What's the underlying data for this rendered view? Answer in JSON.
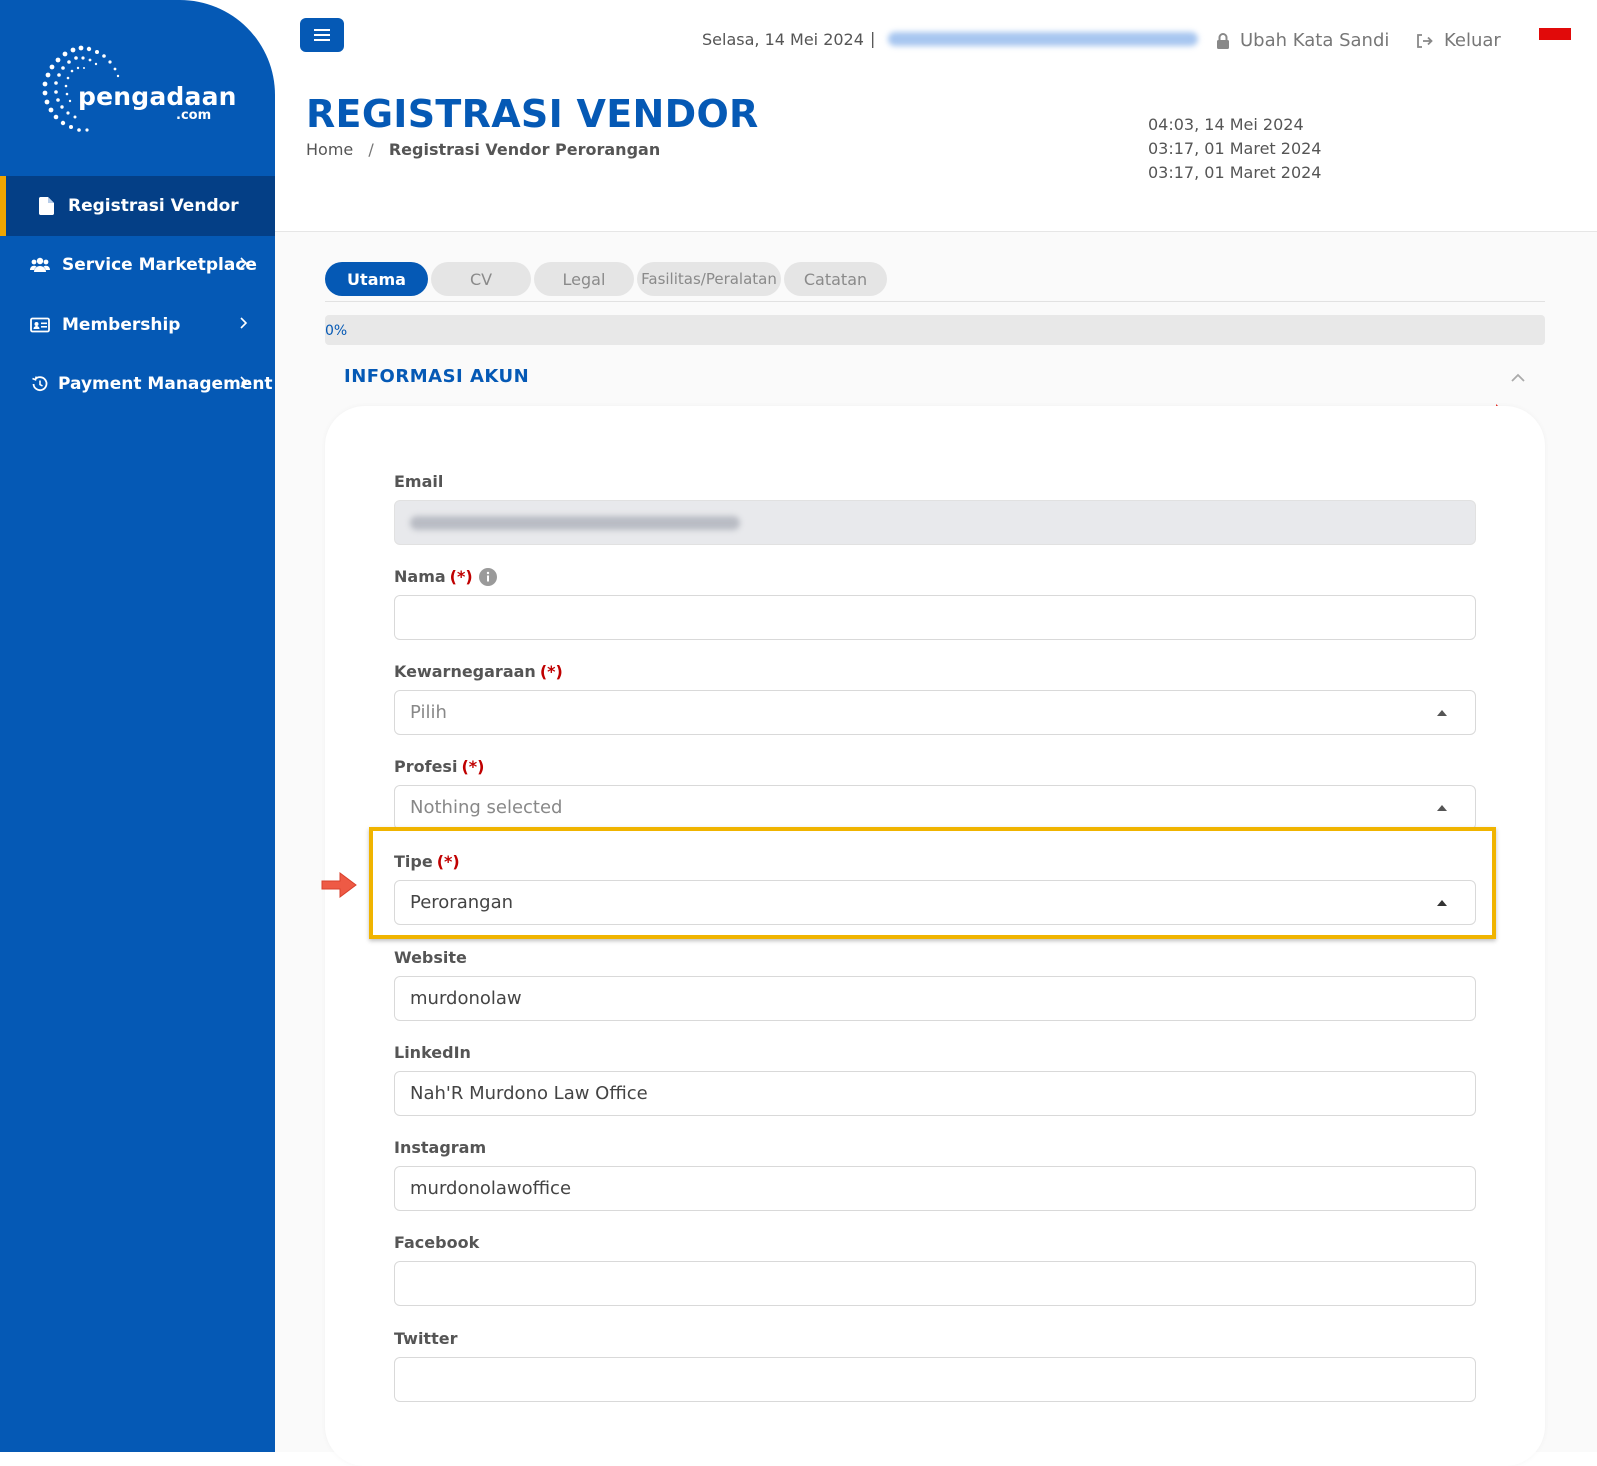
{
  "sidebar": {
    "logo": {
      "text": "pengadaan",
      "sub": ".com"
    },
    "items": [
      {
        "label": "Registrasi Vendor",
        "icon": "document-icon",
        "active": true
      },
      {
        "label": "Service Marketplace",
        "icon": "users-icon",
        "active": false
      },
      {
        "label": "Membership",
        "icon": "id-card-icon",
        "active": false
      },
      {
        "label": "Payment Management",
        "icon": "history-icon",
        "active": false
      }
    ]
  },
  "header": {
    "date": "Selasa, 14 Mei 2024",
    "separator": "|",
    "change_password": "Ubah Kata Sandi",
    "logout": "Keluar"
  },
  "page": {
    "title": "REGISTRASI VENDOR",
    "breadcrumb": {
      "home": "Home",
      "separator": "/",
      "current": "Registrasi Vendor Perorangan"
    },
    "timestamps": [
      "04:03, 14 Mei 2024",
      "03:17, 01 Maret 2024",
      "03:17, 01 Maret 2024"
    ]
  },
  "tabs": [
    {
      "label": "Utama",
      "active": true
    },
    {
      "label": "CV",
      "active": false
    },
    {
      "label": "Legal",
      "active": false
    },
    {
      "label": "Fasilitas/Peralatan",
      "active": false
    },
    {
      "label": "Catatan",
      "active": false
    }
  ],
  "progress": {
    "value": 0,
    "label": "0%"
  },
  "section": {
    "title": "INFORMASI AKUN"
  },
  "form": {
    "required_mark": "(*)",
    "email": {
      "label": "Email"
    },
    "nama": {
      "label": "Nama",
      "value": ""
    },
    "kewarganegaraan": {
      "label": "Kewarnegaraan",
      "placeholder": "Pilih"
    },
    "profesi": {
      "label": "Profesi",
      "placeholder": "Nothing selected"
    },
    "tipe": {
      "label": "Tipe",
      "value": "Perorangan"
    },
    "website": {
      "label": "Website",
      "value": "murdonolaw"
    },
    "linkedin": {
      "label": "LinkedIn",
      "value": "Nah'R Murdono Law Office"
    },
    "instagram": {
      "label": "Instagram",
      "value": "murdonolawoffice"
    },
    "facebook": {
      "label": "Facebook",
      "value": ""
    },
    "twitter": {
      "label": "Twitter",
      "value": ""
    }
  },
  "colors": {
    "primary": "#0559b5",
    "sidebar_active": "#043f86",
    "accent": "#f0a500",
    "highlight": "#f0b400",
    "required": "#c00000",
    "arrow": "#ee5a45"
  }
}
